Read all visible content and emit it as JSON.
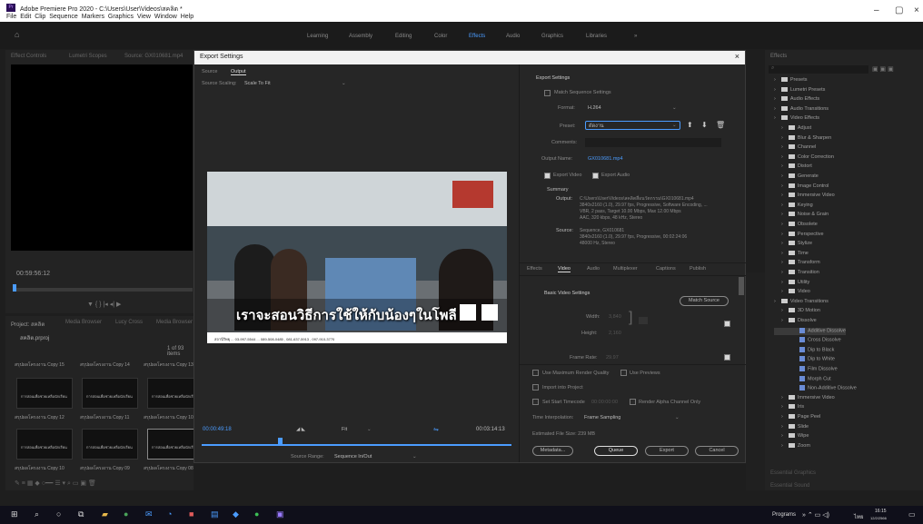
{
  "window": {
    "title": "Adobe Premiere Pro 2020 - C:\\Users\\User\\Videos\\สคลิต *",
    "menu": "File  Edit  Clip  Sequence  Markers  Graphics  View  Window  Help"
  },
  "workspaces": [
    "Learning",
    "Assembly",
    "Editing",
    "Color",
    "Effects",
    "Audio",
    "Graphics",
    "Libraries"
  ],
  "workspace_active": "Effects",
  "left_panel": {
    "tabs": [
      "Effect Controls",
      "Lumetri Scopes",
      "Source: GX010681.mp4"
    ],
    "timecode": "00:59:56:12"
  },
  "project": {
    "tabs": [
      "Project: สคลิต",
      "Media Browser",
      "Lucy Cross",
      "Media Browser"
    ],
    "file": "สคลิต.prproj",
    "count": "1 of 93 items",
    "clips": [
      "สรุปผลโครงงาน Copy 15",
      "สรุปผลโครงงาน Copy 14",
      "สรุปผลโครงงาน Copy 13",
      "สรุปผลโครงงาน Copy 12",
      "สรุปผลโครงงาน Copy 11",
      "สรุปผลโครงงาน Copy 10",
      "สรุปผลโครงงาน Copy 10",
      "สรุปผลโครงงาน Copy 09",
      "สรุปผลโครงงาน Copy 08"
    ],
    "durations": [
      "4:29",
      "4:29",
      "4:29",
      "4:29",
      "4:29",
      "4:29",
      "4:29",
      "4:28",
      "4:23"
    ],
    "thumb_text": "การสอนเพื่อช่วยเหลือนักเรียน"
  },
  "dialog": {
    "title": "Export Settings",
    "close": "×",
    "left": {
      "tabs": [
        "Source",
        "Output"
      ],
      "active_tab": "Output",
      "scaling_label": "Source Scaling:",
      "scaling_value": "Scale To Fit",
      "timecode_in": "00:00:49:18",
      "timecode_out": "00:03:14:13",
      "fit": "Fit",
      "range_label": "Source Range:",
      "range_value": "Sequence In/Out",
      "video_banner": "เราจะสอนวิธีการใช้ให้กับน้องๆในโพลี",
      "video_footer": "สถานีวิทยุ ... 03-997-5544 ... 089-508-0485 , 081-637-5913 , 097-910-3770"
    },
    "right": {
      "section": "Export Settings",
      "match_seq": "Match Sequence Settings",
      "format_label": "Format:",
      "format_value": "H.264",
      "preset_label": "Preset:",
      "preset_value": "ดัดงาน",
      "comments_label": "Comments:",
      "output_label": "Output Name:",
      "output_value": "GX010681.mp4",
      "export_video": "Export Video",
      "export_audio": "Export Audio",
      "summary_title": "Summary",
      "summary_output_label": "Output:",
      "summary_output": "C:\\Users\\User\\Videos\\สคลิตสื่อนวัตกรรม\\GX010681.mp4\n3840x2160 (1.0), 29.97 fps, Progressive, Software Encoding, ...\nVBR, 2 pass, Target 10.00 Mbps, Max 12.00 Mbps\nAAC, 320 kbps, 48 kHz, Stereo",
      "summary_source_label": "Source:",
      "summary_source": "Sequence, GX010681\n3840x2160 (1.0), 29.97 fps, Progressive, 00:02:24:06\n48000 Hz, Stereo",
      "tabs": [
        "Effects",
        "Video",
        "Audio",
        "Multiplexer",
        "Captions",
        "Publish"
      ],
      "active_tab": "Video",
      "basic_video": "Basic Video Settings",
      "match_source": "Match Source",
      "width_label": "Width:",
      "width_value": "3,840",
      "height_label": "Height:",
      "height_value": "2,160",
      "frame_rate_label": "Frame Rate:",
      "frame_rate_value": "29.97",
      "max_render": "Use Maximum Render Quality",
      "use_previews": "Use Previews",
      "import_project": "Import into Project",
      "set_start": "Set Start Timecode",
      "start_tc": "00:00:00:00",
      "render_alpha": "Render Alpha Channel Only",
      "time_interp_label": "Time Interpolation:",
      "time_interp_value": "Frame Sampling",
      "file_size": "Estimated File Size: 239 MB",
      "metadata": "Metadata...",
      "queue": "Queue",
      "export": "Export",
      "cancel": "Cancel"
    }
  },
  "effects": {
    "tab": "Effects",
    "items": [
      {
        "t": "f",
        "l": "Presets",
        "d": 0
      },
      {
        "t": "f",
        "l": "Lumetri Presets",
        "d": 0
      },
      {
        "t": "f",
        "l": "Audio Effects",
        "d": 0
      },
      {
        "t": "f",
        "l": "Audio Transitions",
        "d": 0
      },
      {
        "t": "f",
        "l": "Video Effects",
        "d": 0
      },
      {
        "t": "f",
        "l": "Adjust",
        "d": 1
      },
      {
        "t": "f",
        "l": "Blur & Sharpen",
        "d": 1
      },
      {
        "t": "f",
        "l": "Channel",
        "d": 1
      },
      {
        "t": "f",
        "l": "Color Correction",
        "d": 1
      },
      {
        "t": "f",
        "l": "Distort",
        "d": 1
      },
      {
        "t": "f",
        "l": "Generate",
        "d": 1
      },
      {
        "t": "f",
        "l": "Image Control",
        "d": 1
      },
      {
        "t": "f",
        "l": "Immersive Video",
        "d": 1
      },
      {
        "t": "f",
        "l": "Keying",
        "d": 1
      },
      {
        "t": "f",
        "l": "Noise & Grain",
        "d": 1
      },
      {
        "t": "f",
        "l": "Obsolete",
        "d": 1
      },
      {
        "t": "f",
        "l": "Perspective",
        "d": 1
      },
      {
        "t": "f",
        "l": "Stylize",
        "d": 1
      },
      {
        "t": "f",
        "l": "Time",
        "d": 1
      },
      {
        "t": "f",
        "l": "Transform",
        "d": 1
      },
      {
        "t": "f",
        "l": "Transition",
        "d": 1
      },
      {
        "t": "f",
        "l": "Utility",
        "d": 1
      },
      {
        "t": "f",
        "l": "Video",
        "d": 1
      },
      {
        "t": "f",
        "l": "Video Transitions",
        "d": 0
      },
      {
        "t": "f",
        "l": "3D Motion",
        "d": 1
      },
      {
        "t": "f",
        "l": "Dissolve",
        "d": 1
      },
      {
        "t": "p",
        "l": "Additive Dissolve",
        "d": 2,
        "sel": true
      },
      {
        "t": "p",
        "l": "Cross Dissolve",
        "d": 2
      },
      {
        "t": "p",
        "l": "Dip to Black",
        "d": 2
      },
      {
        "t": "p",
        "l": "Dip to White",
        "d": 2
      },
      {
        "t": "p",
        "l": "Film Dissolve",
        "d": 2
      },
      {
        "t": "p",
        "l": "Morph Cut",
        "d": 2
      },
      {
        "t": "p",
        "l": "Non-Additive Dissolve",
        "d": 2
      },
      {
        "t": "f",
        "l": "Immersive Video",
        "d": 1
      },
      {
        "t": "f",
        "l": "Iris",
        "d": 1
      },
      {
        "t": "f",
        "l": "Page Peel",
        "d": 1
      },
      {
        "t": "f",
        "l": "Slide",
        "d": 1
      },
      {
        "t": "f",
        "l": "Wipe",
        "d": 1
      },
      {
        "t": "f",
        "l": "Zoom",
        "d": 1
      }
    ],
    "bottom": [
      "Essential Graphics",
      "Essential Sound"
    ]
  },
  "taskbar": {
    "programs": "Programs",
    "lang": "ไทย",
    "time": "16:15",
    "date": "12/2/2566"
  },
  "colors": {
    "accent": "#4b9cff",
    "dialog_bg": "#2a2a2a",
    "taskbar": "#0f0f1a"
  }
}
